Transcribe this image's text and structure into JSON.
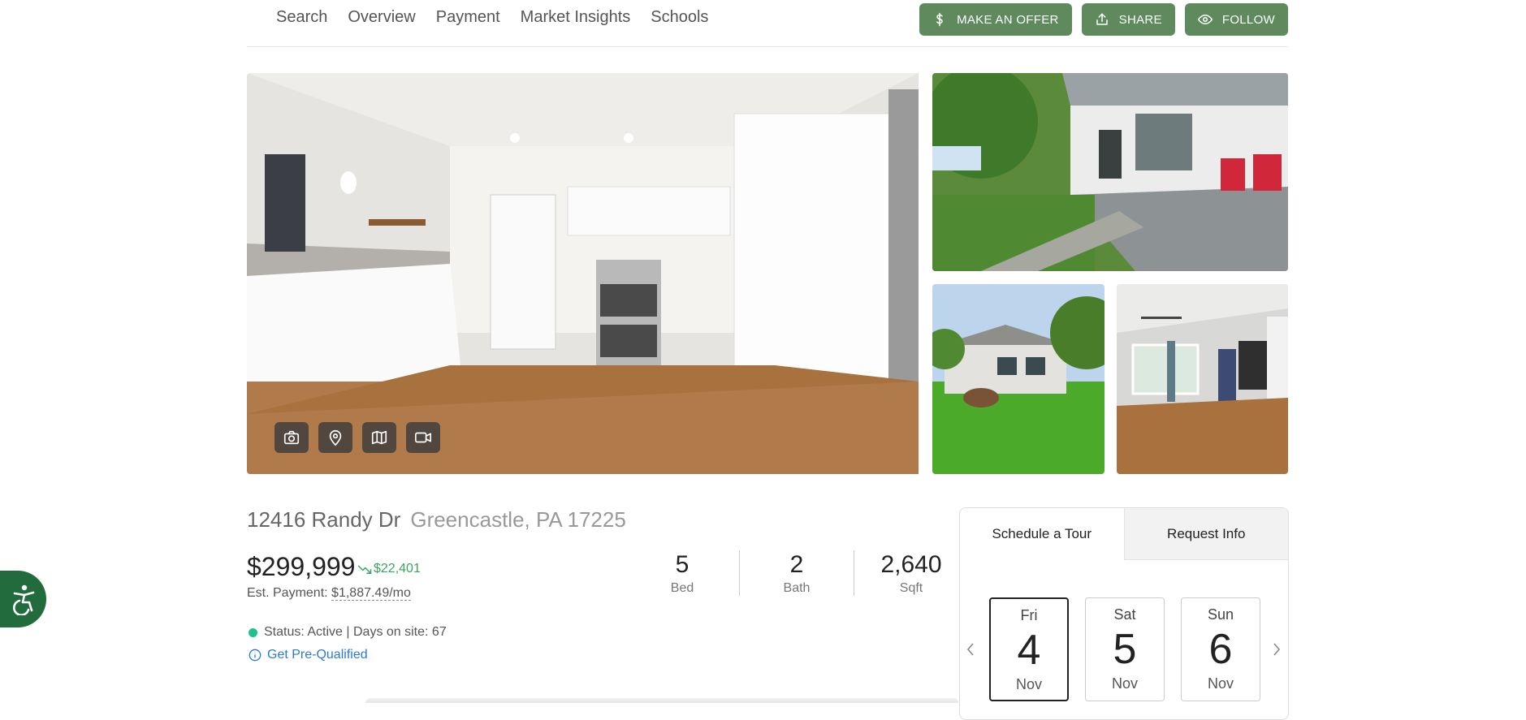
{
  "nav": {
    "links": [
      "Search",
      "Overview",
      "Payment",
      "Market Insights",
      "Schools"
    ]
  },
  "actions": {
    "offer_label": "MAKE AN OFFER",
    "share_label": "SHARE",
    "follow_label": "FOLLOW",
    "color": "#5e8a5e"
  },
  "gallery": {
    "media_buttons": [
      "camera-icon",
      "map-pin-icon",
      "map-icon",
      "video-icon"
    ]
  },
  "listing": {
    "street": "12416 Randy Dr",
    "city": "Greencastle, PA 17225",
    "price": "$299,999",
    "price_change": "$22,401",
    "est_payment_label": "Est. Payment:",
    "est_payment_value": "$1,887.49/mo",
    "status": "Status: Active | Days on site: 67",
    "prequalify": "Get Pre-Qualified",
    "stats": [
      {
        "value": "5",
        "label": "Bed"
      },
      {
        "value": "2",
        "label": "Bath"
      },
      {
        "value": "2,640",
        "label": "Sqft"
      }
    ]
  },
  "schedule": {
    "tabs": [
      "Schedule a Tour",
      "Request Info"
    ],
    "days": [
      {
        "weekday": "Fri",
        "day": "4",
        "month": "Nov"
      },
      {
        "weekday": "Sat",
        "day": "5",
        "month": "Nov"
      },
      {
        "weekday": "Sun",
        "day": "6",
        "month": "Nov"
      }
    ]
  }
}
